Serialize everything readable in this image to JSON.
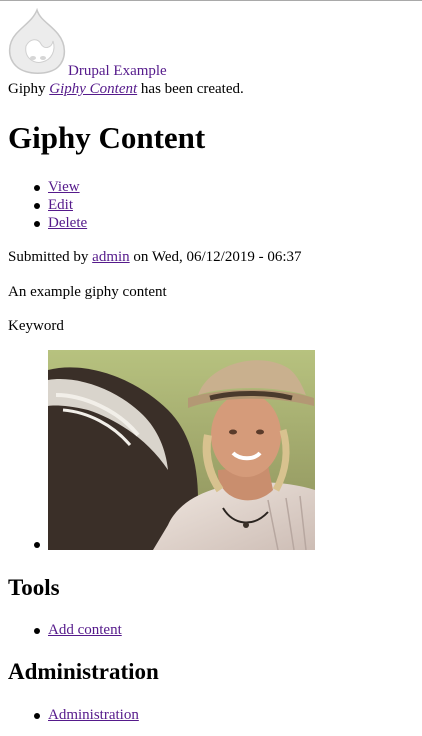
{
  "site": {
    "name": "Drupal Example",
    "logo_icon": "drupal-drop-icon"
  },
  "status_message": {
    "prefix": "Giphy",
    "link": "Giphy Content",
    "suffix": "has been created."
  },
  "node": {
    "title": "Giphy Content",
    "tabs": [
      {
        "label": "View"
      },
      {
        "label": "Edit"
      },
      {
        "label": "Delete"
      }
    ],
    "submitted": {
      "prefix": "Submitted by",
      "author": "admin",
      "date_text": "on Wed, 06/12/2019 - 06:37"
    },
    "body": "An example giphy content",
    "keyword_label": "Keyword"
  },
  "blocks": {
    "tools": {
      "title": "Tools",
      "items": [
        {
          "label": "Add content"
        }
      ]
    },
    "administration": {
      "title": "Administration",
      "items": [
        {
          "label": "Administration"
        }
      ]
    }
  },
  "colors": {
    "link": "#551a8b",
    "topline": "#a9a9a9"
  }
}
